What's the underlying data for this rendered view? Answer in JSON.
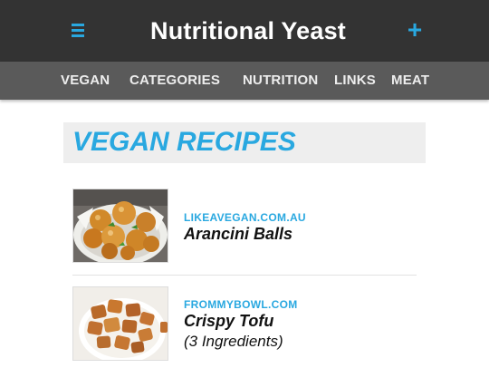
{
  "header": {
    "title": "Nutritional Yeast",
    "menu_icon": "hamburger-menu-icon",
    "add_icon": "plus-icon",
    "add_label": "+"
  },
  "nav": {
    "items": [
      {
        "label": "VEGAN"
      },
      {
        "label": "CATEGORIES"
      },
      {
        "label": "NUTRITION"
      },
      {
        "label": "LINKS"
      },
      {
        "label": "MEAT"
      }
    ]
  },
  "section": {
    "title": "VEGAN RECIPES"
  },
  "recipes": [
    {
      "source": "LIKEAVEGAN.COM.AU",
      "title": "Arancini Balls",
      "subtitle": ""
    },
    {
      "source": "FROMMYBOWL.COM",
      "title": "Crispy Tofu",
      "subtitle": "(3 Ingredients)"
    }
  ],
  "colors": {
    "accent": "#29a8e0",
    "topbar": "#333333",
    "navbar": "#5a5a5a",
    "section_bg": "#eeeeee"
  }
}
